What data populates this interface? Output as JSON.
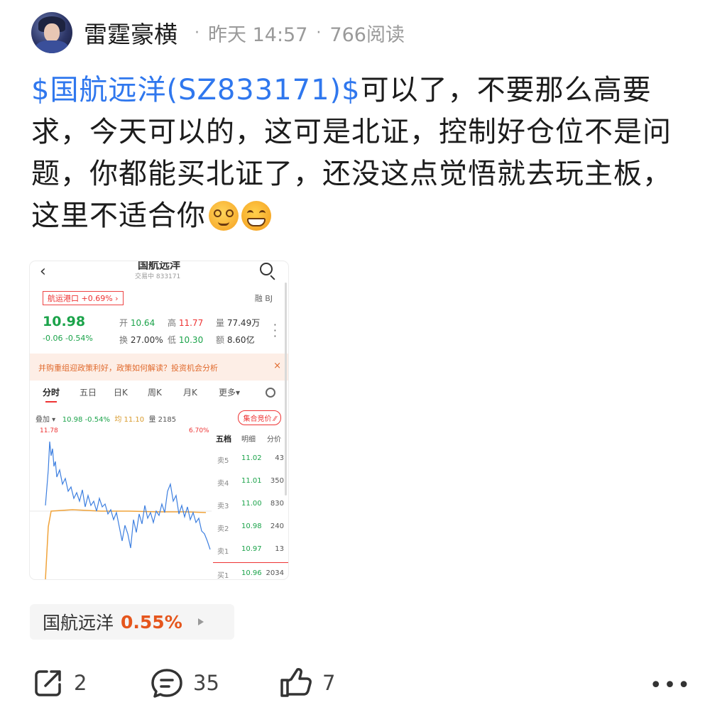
{
  "header": {
    "author": "雷霆豪横",
    "time": "昨天 14:57",
    "reads": "766阅读",
    "separator": "·"
  },
  "post": {
    "stock_link": "$国航远洋(SZ833171)$",
    "text": "可以了，不要那么高要求，今天可以的，这可是北证，控制好仓位不是问题，你都能买北证了，还没这点觉悟就去玩主板，这里不适合你"
  },
  "embedded": {
    "title": "国航远洋",
    "subtitle": "交易中 833171",
    "sector": "航运港口 +0.69% ›",
    "sector_tags": "融 BJ",
    "price": "10.98",
    "change": "-0.06  -0.54%",
    "quotes": {
      "open_label": "开",
      "open": "10.64",
      "high_label": "高",
      "high": "11.77",
      "vol_label": "量",
      "vol": "77.49万",
      "turn_label": "换",
      "turn": "27.00%",
      "low_label": "低",
      "low": "10.30",
      "amt_label": "额",
      "amt": "8.60亿"
    },
    "banner": "并购重组迎政策利好，政策如何解读？投资机会分析",
    "banner_close": "×",
    "tabs": [
      "分时",
      "五日",
      "日K",
      "周K",
      "月K",
      "更多▾"
    ],
    "overlay": {
      "label": "叠加 ▾",
      "price": "10.98",
      "pct": "-0.54%",
      "avg": "均 11.10",
      "vol": "量 2185"
    },
    "auction_button": "集合竞价 ⁄⁄",
    "chart_high": "11.78",
    "chart_high_pct": "6.70%",
    "orderbook": {
      "headers": [
        "五档",
        "明细",
        "分价"
      ],
      "asks": [
        {
          "label": "卖5",
          "price": "11.02",
          "vol": "43"
        },
        {
          "label": "卖4",
          "price": "11.01",
          "vol": "350"
        },
        {
          "label": "卖3",
          "price": "11.00",
          "vol": "830"
        },
        {
          "label": "卖2",
          "price": "10.98",
          "vol": "240"
        },
        {
          "label": "卖1",
          "price": "10.97",
          "vol": "13"
        }
      ],
      "bid1": {
        "label": "买1",
        "price": "10.96",
        "vol": "2034"
      }
    }
  },
  "stock_chip": {
    "name": "国航远洋",
    "pct": "0.55%"
  },
  "actions": {
    "share_count": "2",
    "comment_count": "35",
    "like_count": "7",
    "more": "•••"
  },
  "colors": {
    "link": "#2f77ee",
    "up": "#e33333",
    "down": "#1ba34a",
    "chip_pct": "#e5561d"
  },
  "icons": [
    "share-icon",
    "comment-icon",
    "like-icon",
    "more-icon",
    "search-icon",
    "back-icon",
    "settings-icon"
  ]
}
